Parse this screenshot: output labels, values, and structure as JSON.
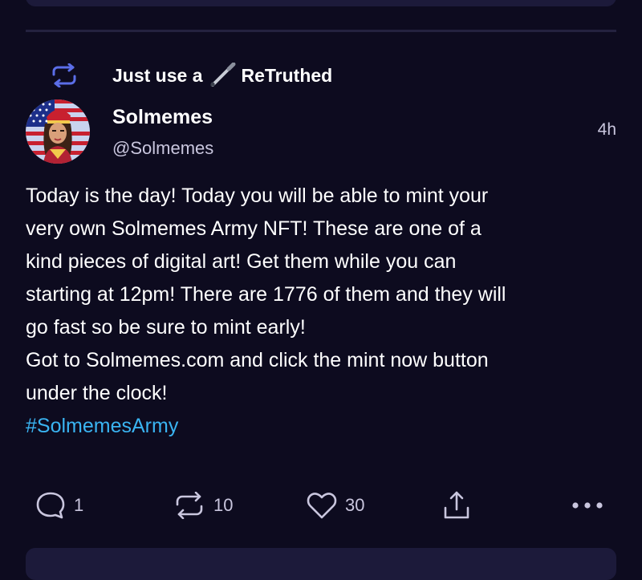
{
  "retruth": {
    "prefix": "Just use a",
    "suffix": "ReTruthed",
    "icon": "retruth-icon"
  },
  "post": {
    "display_name": "Solmemes",
    "handle": "@Solmemes",
    "time": "4h",
    "body_lines": [
      "Today is the day! Today you will be able to mint your",
      "very own Solmemes Army NFT! These are one of a",
      "kind pieces of digital art! Get them while you can",
      "starting at 12pm! There are 1776 of them and they will",
      "go fast so be sure to mint early!",
      "Got to Solmemes.com and click the mint now button",
      "under the clock!"
    ],
    "hashtag": "#SolmemesArmy"
  },
  "actions": {
    "replies": "1",
    "retruths": "10",
    "likes": "30"
  },
  "colors": {
    "background": "#0d0b1f",
    "card": "#1c1a3a",
    "hashtag": "#3ab4f2",
    "muted": "#c9c6de",
    "retruth_icon": "#5b6ee8"
  }
}
